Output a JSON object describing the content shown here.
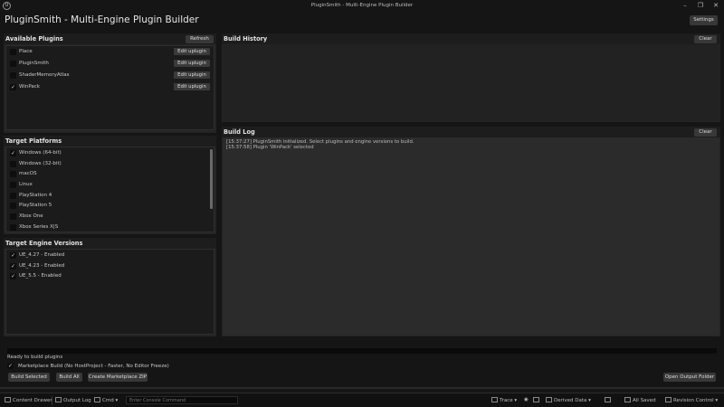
{
  "window": {
    "title": "PluginSmith - Multi-Engine Plugin Builder",
    "logo_glyph": "U"
  },
  "header": {
    "title": "PluginSmith - Multi-Engine Plugin Builder",
    "settings_label": "Settings"
  },
  "plugins": {
    "title": "Available Plugins",
    "refresh_label": "Refresh",
    "edit_label": "Edit uplugin",
    "items": [
      {
        "name": "Place",
        "checked": false
      },
      {
        "name": "PluginSmith",
        "checked": false
      },
      {
        "name": "ShaderMemoryAtlas",
        "checked": false
      },
      {
        "name": "WinPack",
        "checked": true
      }
    ]
  },
  "platforms": {
    "title": "Target Platforms",
    "items": [
      {
        "name": "Windows (64-bit)",
        "checked": true
      },
      {
        "name": "Windows (32-bit)",
        "checked": false
      },
      {
        "name": "macOS",
        "checked": false
      },
      {
        "name": "Linux",
        "checked": false
      },
      {
        "name": "PlayStation 4",
        "checked": false
      },
      {
        "name": "PlayStation 5",
        "checked": false
      },
      {
        "name": "Xbox One",
        "checked": false
      },
      {
        "name": "Xbox Series X|S",
        "checked": false
      }
    ]
  },
  "engines": {
    "title": "Target Engine Versions",
    "items": [
      {
        "name": "UE_4.27 - Enabled",
        "checked": true
      },
      {
        "name": "UE_4.23 - Enabled",
        "checked": true
      },
      {
        "name": "UE_5.5 - Enabled",
        "checked": true
      }
    ]
  },
  "history": {
    "title": "Build History",
    "clear_label": "Clear"
  },
  "log": {
    "title": "Build Log",
    "clear_label": "Clear",
    "lines": [
      "[15:37:27] PluginSmith initialized. Select plugins and engine versions to build.",
      "[15:37:58] Plugin 'WinPack' selected"
    ]
  },
  "footer": {
    "progress": 0,
    "status": "Ready to build plugins",
    "marketplace_label": "Marketplace Build (No HostProject - Faster, No Editor Freeze)",
    "marketplace_checked": true,
    "build_selected": "Build Selected",
    "build_all": "Build All",
    "create_zip": "Create Marketplace ZIP",
    "open_output": "Open Output Folder"
  },
  "statusbar": {
    "content_drawer": "Content Drawer",
    "output_log": "Output Log",
    "cmd": "Cmd",
    "console_placeholder": "Enter Console Command",
    "trace": "Trace",
    "derived_data": "Derived Data",
    "all_saved": "All Saved",
    "revision_control": "Revision Control"
  },
  "colors": {
    "accent": "#3b7fd6",
    "panel": "#242424",
    "background": "#151515"
  }
}
